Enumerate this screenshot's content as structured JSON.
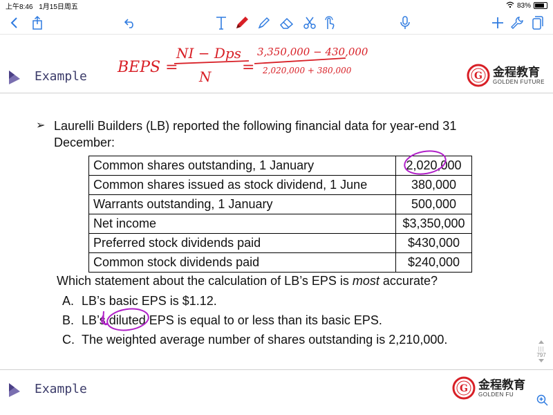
{
  "status_bar": {
    "time": "上午8:46",
    "date": "1月15日周五",
    "battery": "83%",
    "battery_level": 0.83
  },
  "toolbar": {
    "icons": [
      "back-chevron-icon",
      "share-icon",
      "undo-icon",
      "text-tool-icon",
      "pen-icon",
      "highlighter-icon",
      "eraser-icon",
      "scissors-icon",
      "touch-icon",
      "microphone-icon",
      "add-icon",
      "wrench-icon",
      "pages-icon"
    ]
  },
  "header": {
    "title": "Example",
    "brand_name": "金程教育",
    "brand_sub": "GOLDEN FUTURE"
  },
  "question": {
    "bullet": "➢",
    "intro": "Laurelli Builders (LB) reported the following financial data for year-end 31 December:",
    "table": [
      {
        "label": "Common shares outstanding, 1 January",
        "value": "2,020,000"
      },
      {
        "label": "Common shares issued as stock dividend, 1 June",
        "value": "380,000"
      },
      {
        "label": "Warrants outstanding, 1 January",
        "value": "500,000"
      },
      {
        "label": "Net income",
        "value": "$3,350,000"
      },
      {
        "label": "Preferred stock dividends paid",
        "value": "$430,000"
      },
      {
        "label": "Common stock dividends paid",
        "value": "$240,000"
      }
    ],
    "stem_before": "Which statement about the calculation of LB’s EPS is ",
    "stem_emph": "most",
    "stem_after": " accurate?",
    "options": [
      {
        "key": "A.",
        "text": "LB’s basic EPS is $1.12."
      },
      {
        "key": "B.",
        "text": "LB’s diluted EPS is equal to or less than its basic EPS."
      },
      {
        "key": "C.",
        "text": "The weighted average number of shares outstanding is 2,210,000."
      }
    ]
  },
  "annotation": {
    "lhs": "BEPS =",
    "numerator": "NI − Dps",
    "denominator": "N",
    "eq": "=",
    "num2": "3,350,000 − 430,000",
    "den2": "2,020,000 + 380,000",
    "color": "#d81f26"
  },
  "side": {
    "page_number": "797"
  },
  "next_slide": {
    "title": "Example",
    "brand_name": "金程教育",
    "brand_sub": "GOLDEN FU"
  }
}
